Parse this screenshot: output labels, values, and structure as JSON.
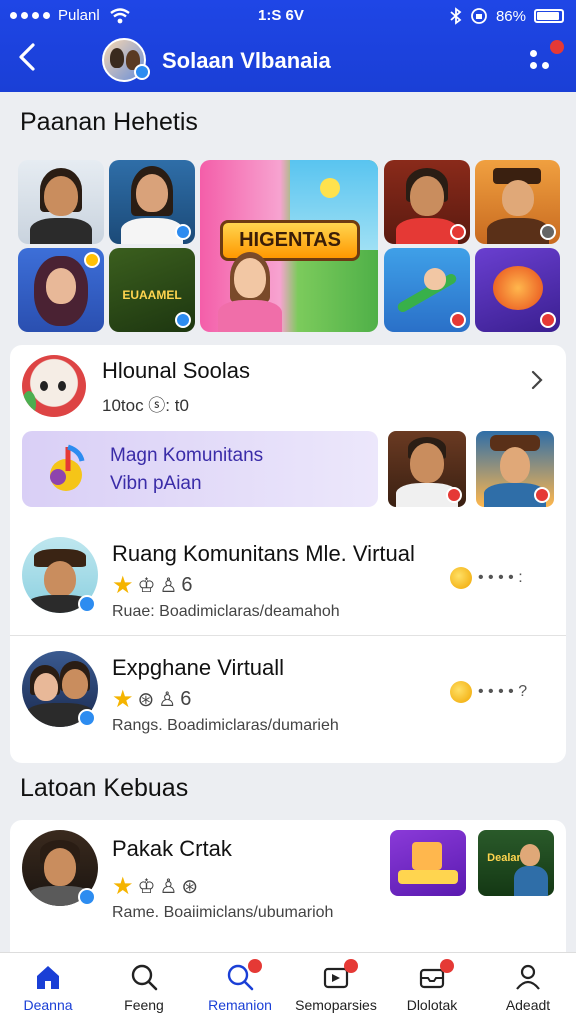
{
  "status_bar": {
    "carrier": "Pulanl",
    "time": "1:S 6V",
    "battery": "86%"
  },
  "header": {
    "back_icon": "chevron-left-icon",
    "title": "Solaan Vlbanaia",
    "menu_icon": "more-dots-icon"
  },
  "section1": {
    "title": "Paanan Hehetis",
    "banner_text": "HIGENTAS",
    "tile2_text": "EUAAMEL"
  },
  "card1": {
    "name": "Hlounal Soolas",
    "meta": "10toc ⓢ: t0",
    "promo_line1": "Magn Komunitans",
    "promo_line2": "Vibn pAian"
  },
  "list": [
    {
      "name": "Ruang Komunitans Mle. Virtual",
      "rating_text": "6",
      "sub": "Ruae: Boadimiclaras/deamahoh"
    },
    {
      "name": "Expghane Virtuall",
      "rating_text": "6",
      "sub": "Rangs. Boadimiclaras/dumarieh"
    }
  ],
  "section2": {
    "title": "Latoan Kebuas"
  },
  "list2": [
    {
      "name": "Pakak Crtak",
      "rating_text": "",
      "sub": "Rame. Boaiimiclans/ubumarioh",
      "thumb_text": "Dealar"
    }
  ],
  "bottom_nav": [
    {
      "label": "Deanna",
      "icon": "home-icon",
      "active": true
    },
    {
      "label": "Feeng",
      "icon": "search-icon",
      "active": false
    },
    {
      "label": "Remanion",
      "icon": "search-badge-icon",
      "active": false
    },
    {
      "label": "Semoparsies",
      "icon": "media-icon",
      "active": false
    },
    {
      "label": "Dlolotak",
      "icon": "inbox-icon",
      "active": false
    },
    {
      "label": "Adeadt",
      "icon": "profile-icon",
      "active": false
    }
  ],
  "colors": {
    "header_blue": "#1f46e6",
    "accent_red": "#e53935",
    "star_gold": "#f5b400",
    "promo_purple": "#3a2ca8"
  }
}
